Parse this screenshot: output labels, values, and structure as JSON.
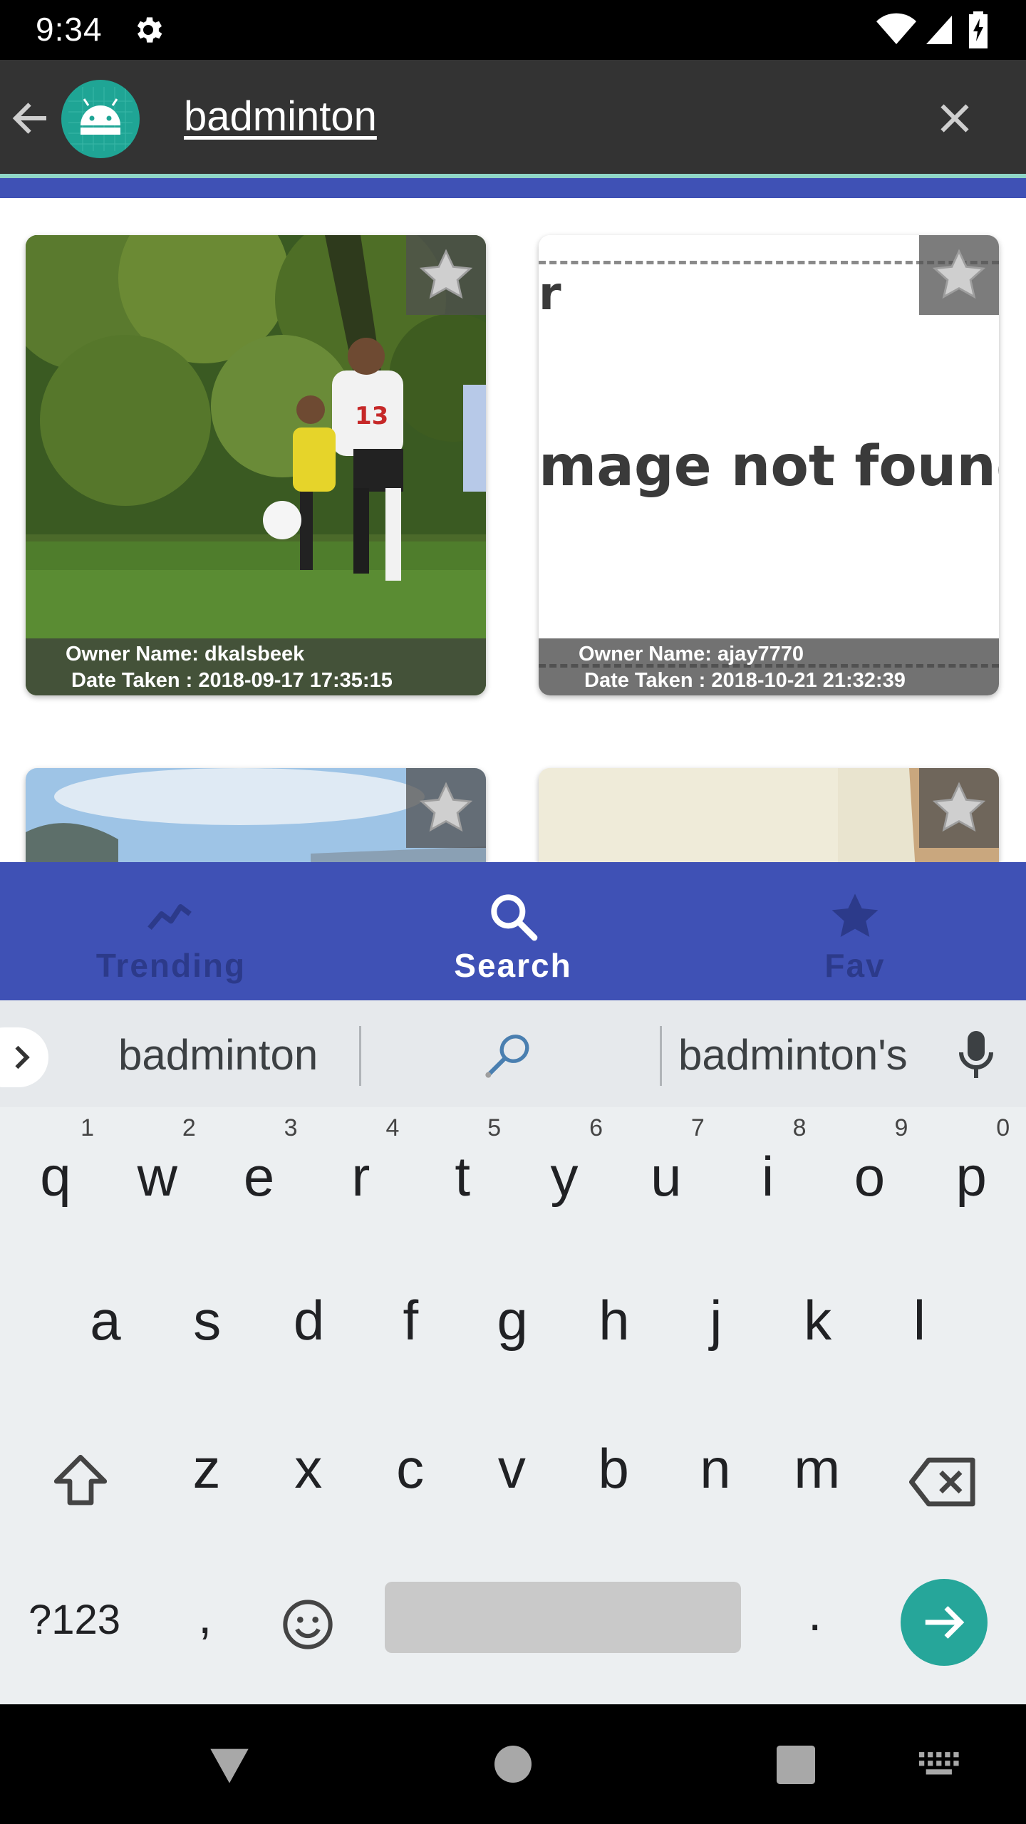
{
  "status_bar": {
    "time": "9:34"
  },
  "search": {
    "query": "badminton"
  },
  "photos": [
    {
      "owner_label": "Owner Name: dkalsbeek",
      "date_label": "Date Taken : 2018-09-17 17:35:15",
      "image_text": ""
    },
    {
      "owner_label": "Owner Name: ajay7770",
      "date_label": "Date Taken : 2018-10-21 21:32:39",
      "image_text": "mage not found",
      "image_corner_text": "r"
    }
  ],
  "bottom_nav": {
    "items": [
      {
        "label": "Trending",
        "icon": "trending-icon",
        "active": false
      },
      {
        "label": "Search",
        "icon": "search-icon",
        "active": true
      },
      {
        "label": "Fav",
        "icon": "star-icon",
        "active": false
      }
    ],
    "color": "#3f51b5"
  },
  "keyboard": {
    "suggestions": [
      "badminton",
      "badminton's"
    ],
    "row1": [
      "q",
      "w",
      "e",
      "r",
      "t",
      "y",
      "u",
      "i",
      "o",
      "p"
    ],
    "row1_hints": [
      "1",
      "2",
      "3",
      "4",
      "5",
      "6",
      "7",
      "8",
      "9",
      "0"
    ],
    "row2": [
      "a",
      "s",
      "d",
      "f",
      "g",
      "h",
      "j",
      "k",
      "l"
    ],
    "row3": [
      "z",
      "x",
      "c",
      "v",
      "b",
      "n",
      "m"
    ],
    "symbols_label": "?123",
    "comma": ",",
    "period": "."
  },
  "colors": {
    "accent": "#26a69a",
    "toolbar": "#333333",
    "primary": "#3f51b5"
  }
}
